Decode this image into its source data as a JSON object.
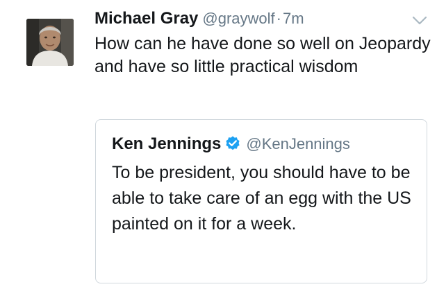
{
  "tweet": {
    "author_name": "Michael Gray",
    "author_handle": "@graywolf",
    "separator": "·",
    "time": "7m",
    "avatar_icon": "profile-photo",
    "menu_icon": "chevron-down-icon",
    "text": "How can he have done so well on Jeopardy and have so little practical wisdom"
  },
  "quoted_tweet": {
    "author_name": "Ken Jennings",
    "verified_icon": "verified-badge-icon",
    "author_handle": "@KenJennings",
    "text": "To be president, you should have to be able to take care of an egg with the US painted on it for a week."
  },
  "colors": {
    "text_primary": "#14171a",
    "text_secondary": "#657786",
    "verified_blue": "#1da1f2",
    "border": "#d0d7dd",
    "caret": "#aab8c2"
  }
}
